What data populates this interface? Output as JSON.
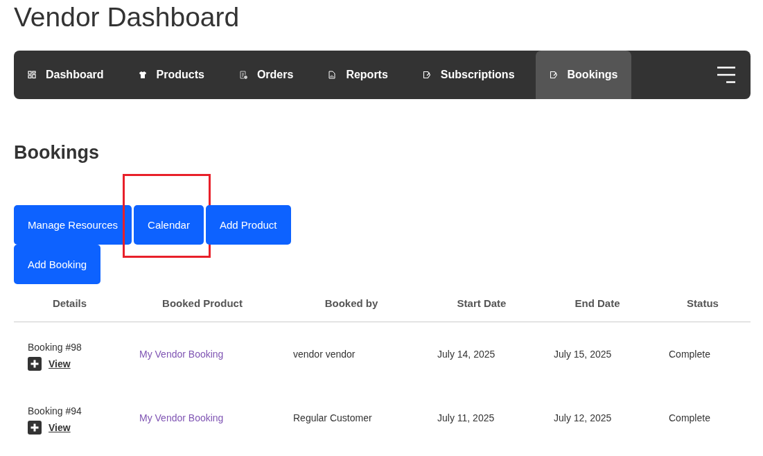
{
  "page_title": "Vendor Dashboard",
  "nav": [
    {
      "label": "Dashboard",
      "kind": "grid",
      "selected": false
    },
    {
      "label": "Products",
      "kind": "shirt",
      "selected": false
    },
    {
      "label": "Orders",
      "kind": "receipt",
      "selected": false
    },
    {
      "label": "Reports",
      "kind": "report",
      "selected": false
    },
    {
      "label": "Subscriptions",
      "kind": "tag",
      "selected": false
    },
    {
      "label": "Bookings",
      "kind": "tag",
      "selected": true
    }
  ],
  "heading": "Bookings",
  "buttons": [
    {
      "label": "Manage Resources",
      "highlighted": false
    },
    {
      "label": "Calendar",
      "highlighted": true
    },
    {
      "label": "Add Product",
      "highlighted": false
    },
    {
      "label": "Add Booking",
      "highlighted": false
    }
  ],
  "table": {
    "columns": [
      "Details",
      "Booked Product",
      "Booked by",
      "Start Date",
      "End Date",
      "Status"
    ],
    "rows": [
      {
        "booking": "Booking #98",
        "view": "View",
        "product": "My Vendor Booking",
        "booked_by": "vendor vendor",
        "start": "July 14, 2025",
        "end": "July 15, 2025",
        "status": "Complete"
      },
      {
        "booking": "Booking #94",
        "view": "View",
        "product": "My Vendor Booking",
        "booked_by": "Regular Customer",
        "start": "July 11, 2025",
        "end": "July 12, 2025",
        "status": "Complete"
      }
    ]
  }
}
